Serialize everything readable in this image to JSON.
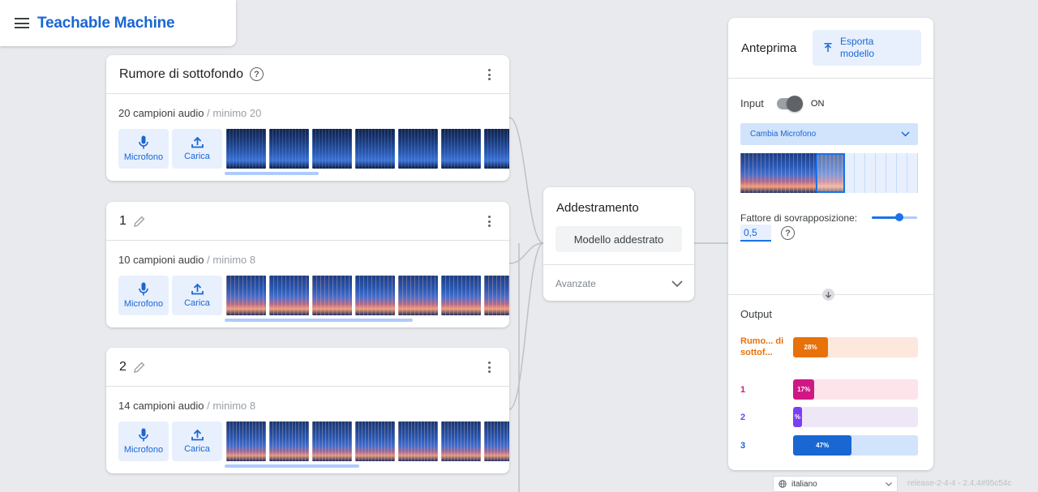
{
  "app": {
    "title": "Teachable Machine"
  },
  "classes": [
    {
      "name": "Rumore di sottofondo",
      "count_text": "20 campioni audio",
      "min_text": " / minimo 20",
      "mic_label": "Microfono",
      "upload_label": "Carica"
    },
    {
      "name": "1",
      "count_text": "10 campioni audio",
      "min_text": " / minimo 8",
      "mic_label": "Microfono",
      "upload_label": "Carica"
    },
    {
      "name": "2",
      "count_text": "14 campioni audio",
      "min_text": " / minimo 8",
      "mic_label": "Microfono",
      "upload_label": "Carica"
    }
  ],
  "training": {
    "title": "Addestramento",
    "button_label": "Modello addestrato",
    "advanced_label": "Avanzate"
  },
  "preview": {
    "title": "Anteprima",
    "export_label": "Esporta modello",
    "input_label": "Input",
    "toggle_state": "ON",
    "mic_select_label": "Cambia Microfono",
    "overlap_label": "Fattore di sovrapposizione:",
    "overlap_value": "0,5",
    "overlap_slider_fraction": 0.6,
    "output_title": "Output",
    "outputs": [
      {
        "label": "Rumo... di sottof...",
        "percent_text": "28%",
        "fraction": 0.28,
        "color": "#e8710a",
        "track": "#fde8dd"
      },
      {
        "label": "1",
        "percent_text": "17%",
        "fraction": 0.17,
        "color": "#d01884",
        "track": "#fce4ea"
      },
      {
        "label": "2",
        "percent_text": "%",
        "fraction": 0.07,
        "color": "#7b3ff2",
        "track": "#ede7f6"
      },
      {
        "label": "3",
        "percent_text": "47%",
        "fraction": 0.47,
        "color": "#1967d2",
        "track": "#d2e3fc"
      }
    ]
  },
  "footer": {
    "language": "italiano",
    "release": "release-2-4-4 - 2.4.4#95c54c"
  }
}
